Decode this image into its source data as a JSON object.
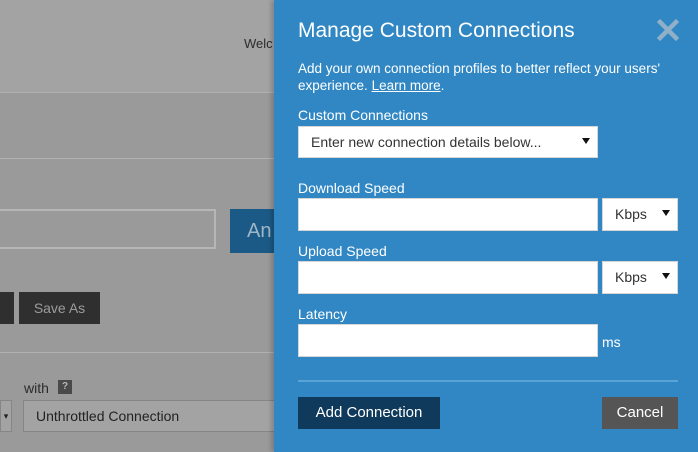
{
  "background": {
    "welcome_text": "Welc",
    "analyze_button_partial": "An",
    "save_as_button": "Save As",
    "with_label": "with",
    "help_badge": "?",
    "connection_select_value": "Unthrottled Connection"
  },
  "modal": {
    "title": "Manage Custom Connections",
    "description": "Add your own connection profiles to better reflect your users' experience.",
    "learn_more_link": "Learn more",
    "learn_more_suffix": ".",
    "custom_connections_label": "Custom Connections",
    "custom_connections_value": "Enter new connection details below...",
    "download_speed_label": "Download Speed",
    "download_speed_value": "",
    "download_unit": "Kbps",
    "upload_speed_label": "Upload Speed",
    "upload_speed_value": "",
    "upload_unit": "Kbps",
    "latency_label": "Latency",
    "latency_value": "",
    "latency_unit": "ms",
    "add_button": "Add Connection",
    "cancel_button": "Cancel"
  },
  "colors": {
    "modal_background": "#3087c3",
    "add_button": "#0f3a5c",
    "cancel_button": "#555555",
    "overlay": "#9a9a9a"
  },
  "icons": {
    "close": "close-icon",
    "dropdown": "chevron-down-icon"
  }
}
